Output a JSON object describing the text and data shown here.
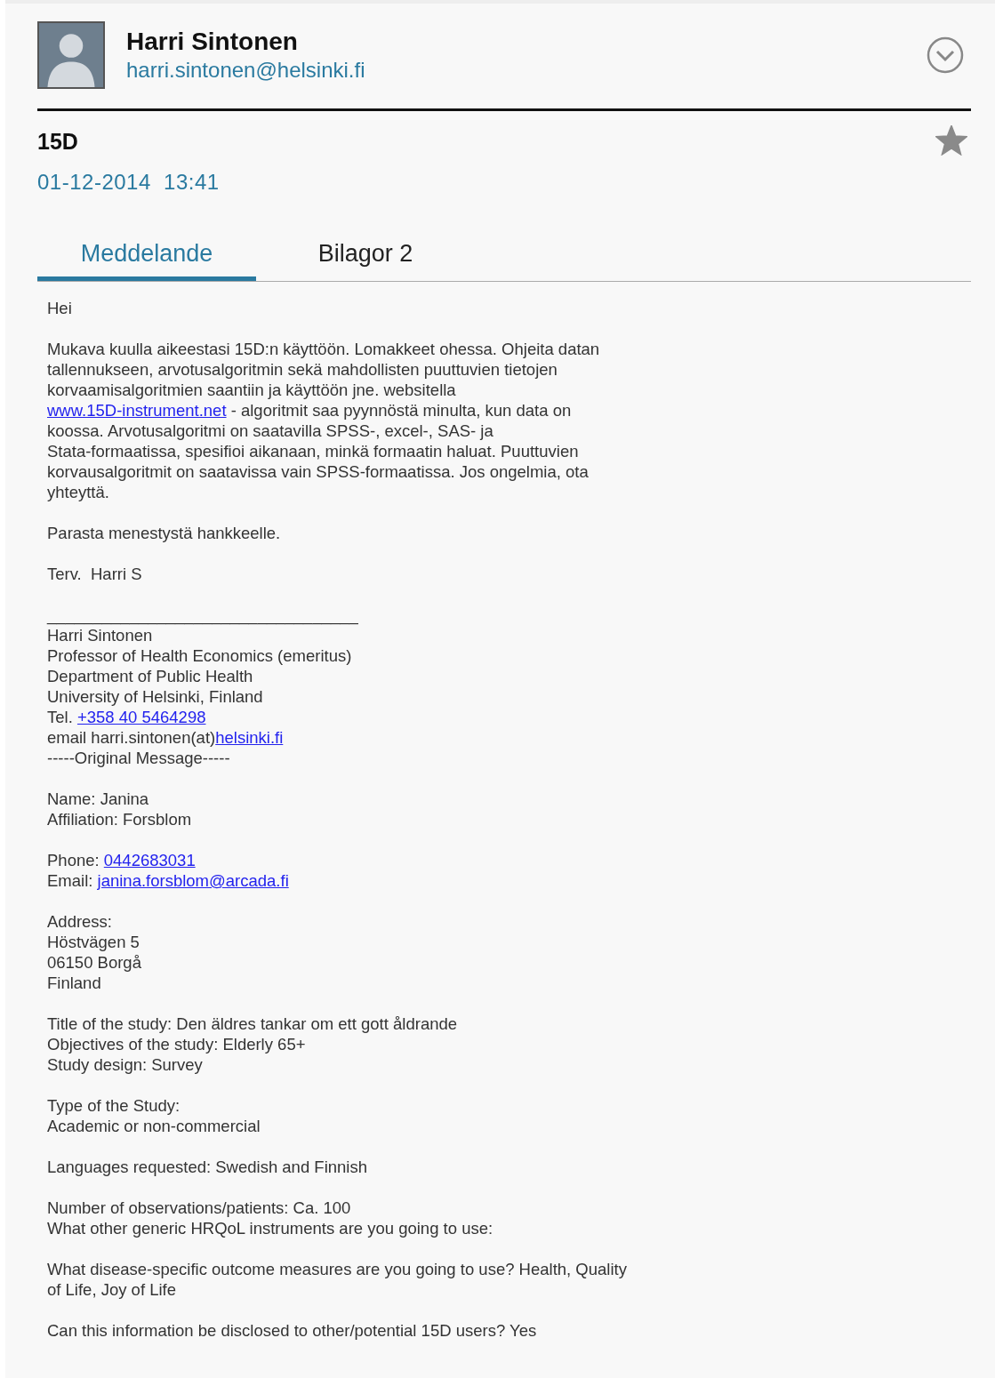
{
  "sender": {
    "name": "Harri Sintonen",
    "email": "harri.sintonen@helsinki.fi"
  },
  "subject": "15D",
  "date": "01-12-2014  13:41",
  "starred": true,
  "tabs": [
    {
      "label": "Meddelande",
      "selected": true
    },
    {
      "label": "Bilagor 2",
      "selected": false
    }
  ],
  "body": [
    [
      [
        {
          "text": "Hei"
        }
      ]
    ],
    [
      [
        {
          "text": "Mukava kuulla aikeestasi 15D:n käyttöön. Lomakkeet ohessa. Ohjeita datan"
        }
      ],
      [
        {
          "text": "tallennukseen, arvotusalgoritmin sekä mahdollisten puuttuvien tietojen"
        }
      ],
      [
        {
          "text": "korvaamisalgoritmien saantiin ja käyttöön jne. websitella"
        }
      ],
      [
        {
          "text": "www.15D-instrument.net",
          "kind": "link"
        },
        {
          "text": " - algoritmit saa pyynnöstä minulta, kun data on"
        }
      ],
      [
        {
          "text": "koossa. Arvotusalgoritmi on saatavilla SPSS-, excel-, SAS- ja"
        }
      ],
      [
        {
          "text": "Stata-formaatissa, spesifioi aikanaan, minkä formaatin haluat. Puuttuvien"
        }
      ],
      [
        {
          "text": "korvausalgoritmit on saatavissa vain SPSS-formaatissa. Jos ongelmia, ota"
        }
      ],
      [
        {
          "text": "yhteyttä."
        }
      ]
    ],
    [
      [
        {
          "text": "Parasta menestystä hankkeelle."
        }
      ]
    ],
    [
      [
        {
          "text": "Terv.  Harri S"
        }
      ]
    ],
    [
      [
        {
          "text": "__________________________________"
        }
      ],
      [
        {
          "text": "Harri Sintonen"
        }
      ],
      [
        {
          "text": "Professor of Health Economics (emeritus)"
        }
      ],
      [
        {
          "text": "Department of Public Health"
        }
      ],
      [
        {
          "text": "University of Helsinki, Finland"
        }
      ],
      [
        {
          "text": "Tel. "
        },
        {
          "text": "+358 40 5464298",
          "kind": "link"
        }
      ],
      [
        {
          "text": "email harri.sintonen(at)"
        },
        {
          "text": "helsinki.fi",
          "kind": "link"
        }
      ],
      [
        {
          "text": "-----Original Message-----"
        }
      ]
    ],
    [
      [
        {
          "text": "Name: Janina"
        }
      ],
      [
        {
          "text": "Affiliation: Forsblom"
        }
      ]
    ],
    [
      [
        {
          "text": "Phone: "
        },
        {
          "text": "0442683031",
          "kind": "link"
        }
      ],
      [
        {
          "text": "Email: "
        },
        {
          "text": "janina.forsblom@arcada.fi",
          "kind": "link"
        }
      ]
    ],
    [
      [
        {
          "text": "Address:"
        }
      ],
      [
        {
          "text": "Höstvägen 5"
        }
      ],
      [
        {
          "text": "06150 Borgå"
        }
      ],
      [
        {
          "text": "Finland"
        }
      ]
    ],
    [
      [
        {
          "text": "Title of the study: Den äldres tankar om ett gott åldrande"
        }
      ],
      [
        {
          "text": "Objectives of the study: Elderly 65+"
        }
      ],
      [
        {
          "text": "Study design: Survey"
        }
      ]
    ],
    [
      [
        {
          "text": "Type of the Study:"
        }
      ],
      [
        {
          "text": "Academic or non-commercial"
        }
      ]
    ],
    [
      [
        {
          "text": "Languages requested: Swedish and Finnish"
        }
      ]
    ],
    [
      [
        {
          "text": "Number of observations/patients: Ca. 100"
        }
      ],
      [
        {
          "text": "What other generic HRQoL instruments are you going to use:"
        }
      ]
    ],
    [
      [
        {
          "text": "What disease-specific outcome measures are you going to use? Health, Quality"
        }
      ],
      [
        {
          "text": "of Life, Joy of Life"
        }
      ]
    ],
    [
      [
        {
          "text": "Can this information be disclosed to other/potential 15D users? Yes"
        }
      ]
    ]
  ]
}
